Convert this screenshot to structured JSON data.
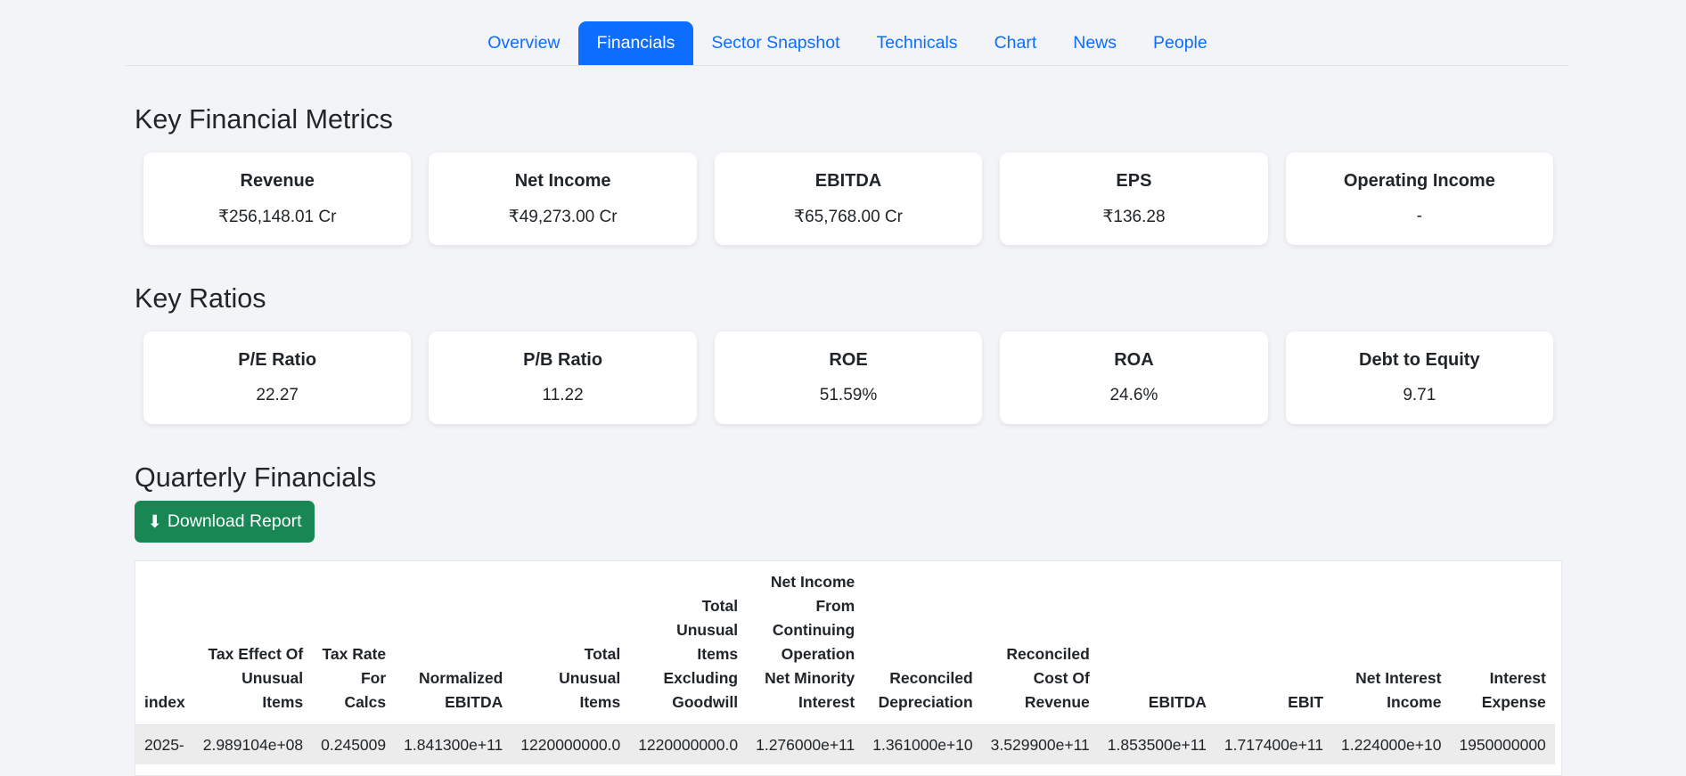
{
  "tabs": [
    "Overview",
    "Financials",
    "Sector Snapshot",
    "Technicals",
    "Chart",
    "News",
    "People"
  ],
  "active_tab": "Financials",
  "key_metrics": {
    "title": "Key Financial Metrics",
    "cards": [
      {
        "label": "Revenue",
        "value": "₹256,148.01 Cr"
      },
      {
        "label": "Net Income",
        "value": "₹49,273.00 Cr"
      },
      {
        "label": "EBITDA",
        "value": "₹65,768.00 Cr"
      },
      {
        "label": "EPS",
        "value": "₹136.28"
      },
      {
        "label": "Operating Income",
        "value": "-"
      }
    ]
  },
  "key_ratios": {
    "title": "Key Ratios",
    "cards": [
      {
        "label": "P/E Ratio",
        "value": "22.27"
      },
      {
        "label": "P/B Ratio",
        "value": "11.22"
      },
      {
        "label": "ROE",
        "value": "51.59%"
      },
      {
        "label": "ROA",
        "value": "24.6%"
      },
      {
        "label": "Debt to Equity",
        "value": "9.71"
      }
    ]
  },
  "quarterly": {
    "title": "Quarterly Financials",
    "download_icon": "⬇",
    "download_label": "Download Report",
    "columns": [
      [
        "index"
      ],
      [
        "Tax Effect Of",
        "Unusual",
        "Items"
      ],
      [
        "Tax Rate",
        "For",
        "Calcs"
      ],
      [
        "Normalized",
        "EBITDA"
      ],
      [
        "Total",
        "Unusual",
        "Items"
      ],
      [
        "Total",
        "Unusual",
        "Items",
        "Excluding",
        "Goodwill"
      ],
      [
        "Net Income",
        "From",
        "Continuing",
        "Operation",
        "Net Minority",
        "Interest"
      ],
      [
        "Reconciled",
        "Depreciation"
      ],
      [
        "Reconciled",
        "Cost Of",
        "Revenue"
      ],
      [
        "EBITDA"
      ],
      [
        "EBIT"
      ],
      [
        "Net Interest",
        "Income"
      ],
      [
        "Interest",
        "Expense"
      ]
    ],
    "rows": [
      [
        "2025-",
        "2.989104e+08",
        "0.245009",
        "1.841300e+11",
        "1220000000.0",
        "1220000000.0",
        "1.276000e+11",
        "1.361000e+10",
        "3.529900e+11",
        "1.853500e+11",
        "1.717400e+11",
        "1.224000e+10",
        "1950000000"
      ]
    ]
  }
}
